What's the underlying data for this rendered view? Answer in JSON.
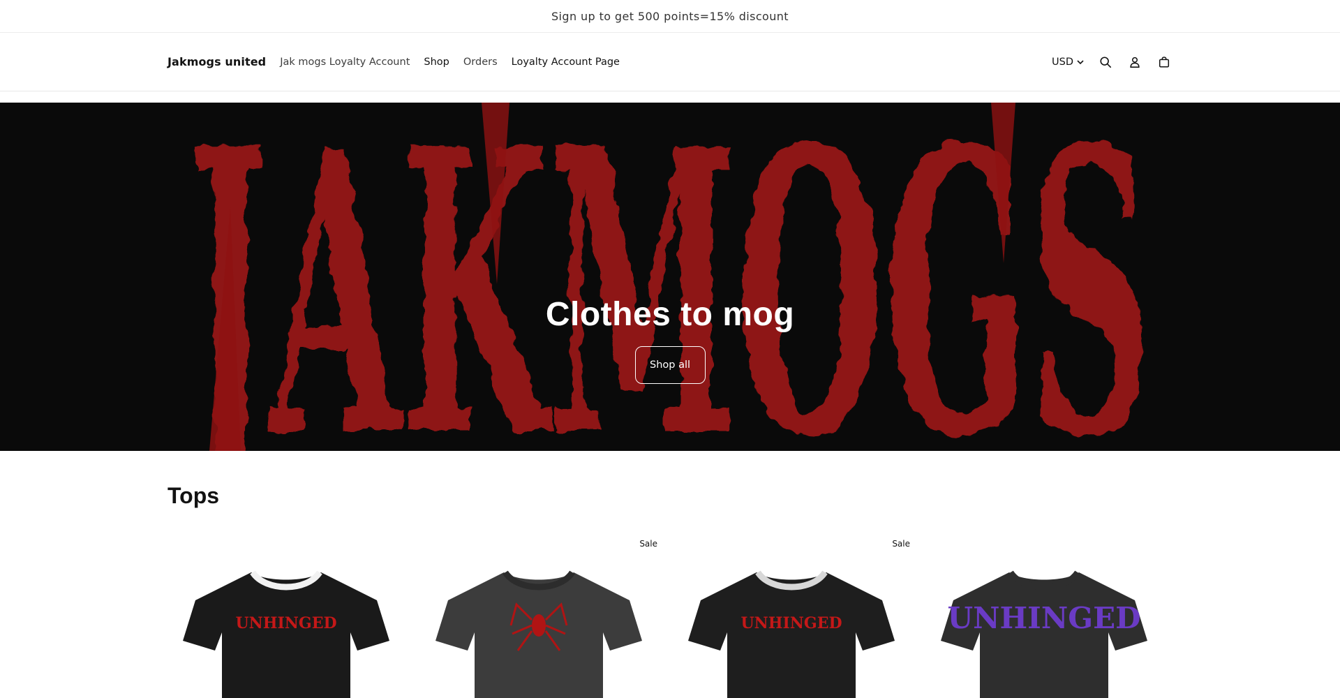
{
  "announcement": {
    "text": "Sign up to get 500 points=15% discount"
  },
  "header": {
    "logo": "Jakmogs united",
    "nav": [
      {
        "label": "Jak mogs Loyalty Account"
      },
      {
        "label": "Shop"
      },
      {
        "label": "Orders"
      },
      {
        "label": "Loyalty Account Page"
      }
    ],
    "currency": "USD",
    "icons": [
      "search-icon",
      "account-icon",
      "cart-icon"
    ]
  },
  "hero": {
    "background_text": "JAKMOGS",
    "title": "Clothes to mog",
    "button_label": "Shop all",
    "colors": {
      "background": "#0a0a0a",
      "lettering": "#8e1212"
    }
  },
  "collection": {
    "title": "Tops",
    "products": [
      {
        "badge": "",
        "shirt_color": "#1a1a1a",
        "trim_color": "#f2f2f2",
        "print_text": "UNHINGED",
        "print_color": "#c41818"
      },
      {
        "badge": "Sale",
        "shirt_color": "#3c3c3c",
        "trim_color": "#2c2c2c",
        "print_text": "",
        "print_color": "#b01414"
      },
      {
        "badge": "Sale",
        "shirt_color": "#1e1e1e",
        "trim_color": "#d8d8d8",
        "print_text": "UNHINGED",
        "print_color": "#c41818"
      },
      {
        "badge": "",
        "shirt_color": "#2e2e2e",
        "trim_color": "#2e2e2e",
        "print_text": "UNHINGED",
        "print_color": "#6a3bc4"
      }
    ]
  }
}
